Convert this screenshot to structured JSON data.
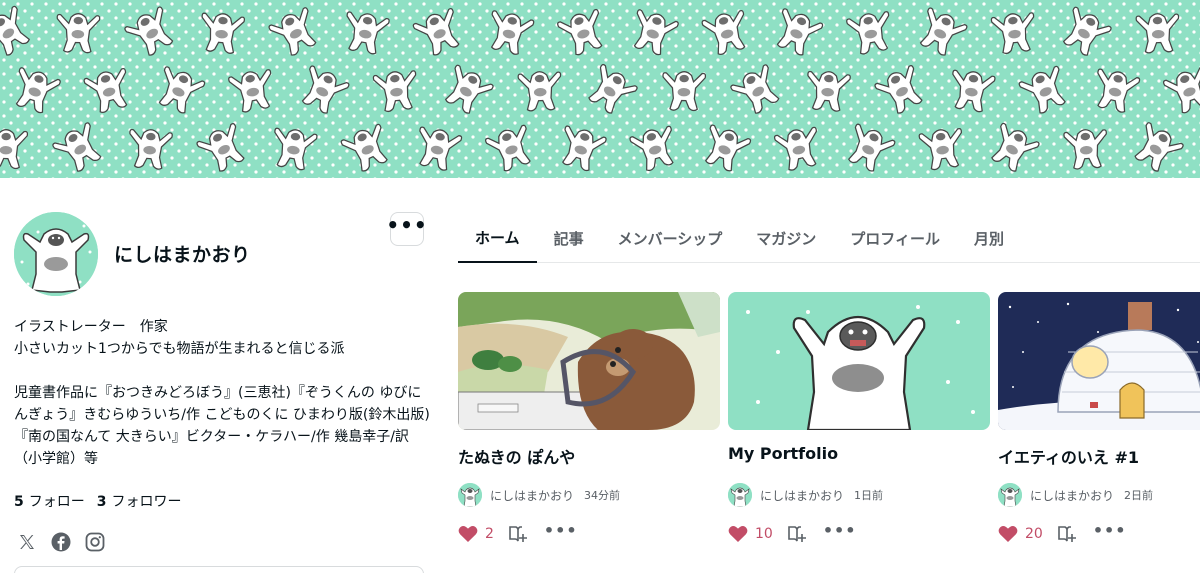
{
  "banner": {
    "background": "#8fe0c4",
    "pattern_icon": "yeti-icon"
  },
  "profile": {
    "name": "にしはまかおり",
    "more_label": "•••",
    "bio": "イラストレーター　作家\n小さいカット1つからでも物語が生まれると信じる派\n\n児童書作品に『おつきみどろぼう』(三恵社)『ぞうくんの ゆびにんぎょう』きむらゆういち/作 こどものくに ひまわり版(鈴木出版)『南の国なんて 大きらい』ビクター・ケラハー/作 幾島幸子/訳（小学館）等",
    "follow_count": "5",
    "follow_label": "フォロー",
    "follower_count": "3",
    "follower_label": "フォロワー",
    "socials": [
      "x-icon",
      "facebook-icon",
      "instagram-icon"
    ]
  },
  "tabs": [
    {
      "label": "ホーム",
      "active": true
    },
    {
      "label": "記事"
    },
    {
      "label": "メンバーシップ"
    },
    {
      "label": "マガジン"
    },
    {
      "label": "プロフィール"
    },
    {
      "label": "月別"
    }
  ],
  "cards": [
    {
      "title": "たぬきの ぽんや",
      "author": "にしはまかおり",
      "time": "34分前",
      "likes": "2"
    },
    {
      "title": "My Portfolio",
      "author": "にしはまかおり",
      "time": "1日前",
      "likes": "10"
    },
    {
      "title": "イエティのいえ #1",
      "author": "にしはまかおり",
      "time": "2日前",
      "likes": "20"
    }
  ],
  "colors": {
    "accent_like": "#c24d67",
    "mint": "#8fe0c4",
    "text": "#08131a",
    "muted": "#5a6066"
  }
}
